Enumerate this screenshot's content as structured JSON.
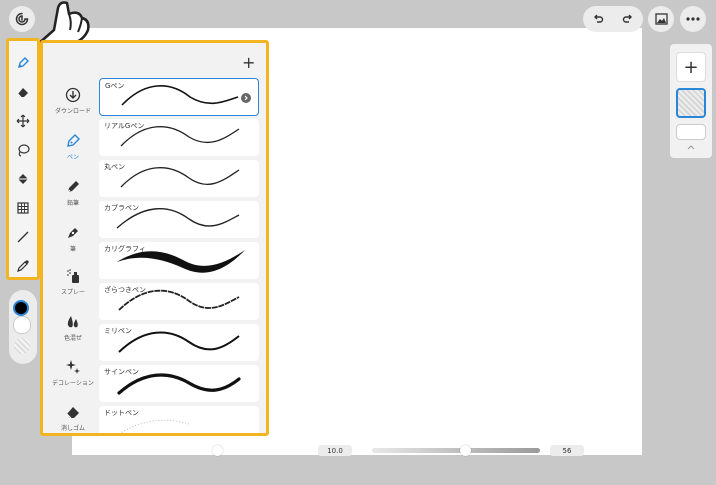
{
  "header": {
    "app_icon": "app-logo-icon",
    "undo_icon": "undo-icon",
    "redo_icon": "redo-icon",
    "gallery_icon": "image-icon",
    "more_icon": "more-icon"
  },
  "toolbar": {
    "tools": [
      {
        "name": "pen-tool",
        "icon": "pen-icon",
        "active": true
      },
      {
        "name": "eraser-tool",
        "icon": "eraser-icon"
      },
      {
        "name": "move-tool",
        "icon": "move-icon"
      },
      {
        "name": "lasso-tool",
        "icon": "lasso-icon"
      },
      {
        "name": "fill-tool",
        "icon": "bucket-icon"
      },
      {
        "name": "filter-tool",
        "icon": "grid-icon"
      },
      {
        "name": "line-tool",
        "icon": "line-icon"
      },
      {
        "name": "eyedropper-tool",
        "icon": "eyedropper-icon"
      }
    ]
  },
  "colors": {
    "accent": "#2a87d8",
    "highlight": "#f2b521",
    "primary_color": "#000000",
    "secondary_color": "#ffffff"
  },
  "brush_panel": {
    "add_label": "+",
    "categories": [
      {
        "label": "ダウンロード",
        "icon": "download-icon"
      },
      {
        "label": "ペン",
        "icon": "pen-icon",
        "active": true
      },
      {
        "label": "鉛筆",
        "icon": "pencil-icon"
      },
      {
        "label": "筆",
        "icon": "brush-icon"
      },
      {
        "label": "スプレー",
        "icon": "spray-icon"
      },
      {
        "label": "色混ぜ",
        "icon": "blend-icon"
      },
      {
        "label": "デコレーション",
        "icon": "sparkle-icon"
      },
      {
        "label": "消しゴム",
        "icon": "eraser-icon"
      }
    ],
    "brushes": [
      {
        "name": "Gペン",
        "selected": true
      },
      {
        "name": "リアルGペン"
      },
      {
        "name": "丸ペン"
      },
      {
        "name": "カブラペン"
      },
      {
        "name": "カリグラフィ"
      },
      {
        "name": "ざらつきペン"
      },
      {
        "name": "ミリペン"
      },
      {
        "name": "サインペン"
      },
      {
        "name": "ドットペン"
      }
    ]
  },
  "bottom_bar": {
    "size_value": "10.0",
    "opacity_value": "56"
  },
  "layers": {
    "add_label": "+",
    "collapse_icon": "chevron-up-icon"
  }
}
